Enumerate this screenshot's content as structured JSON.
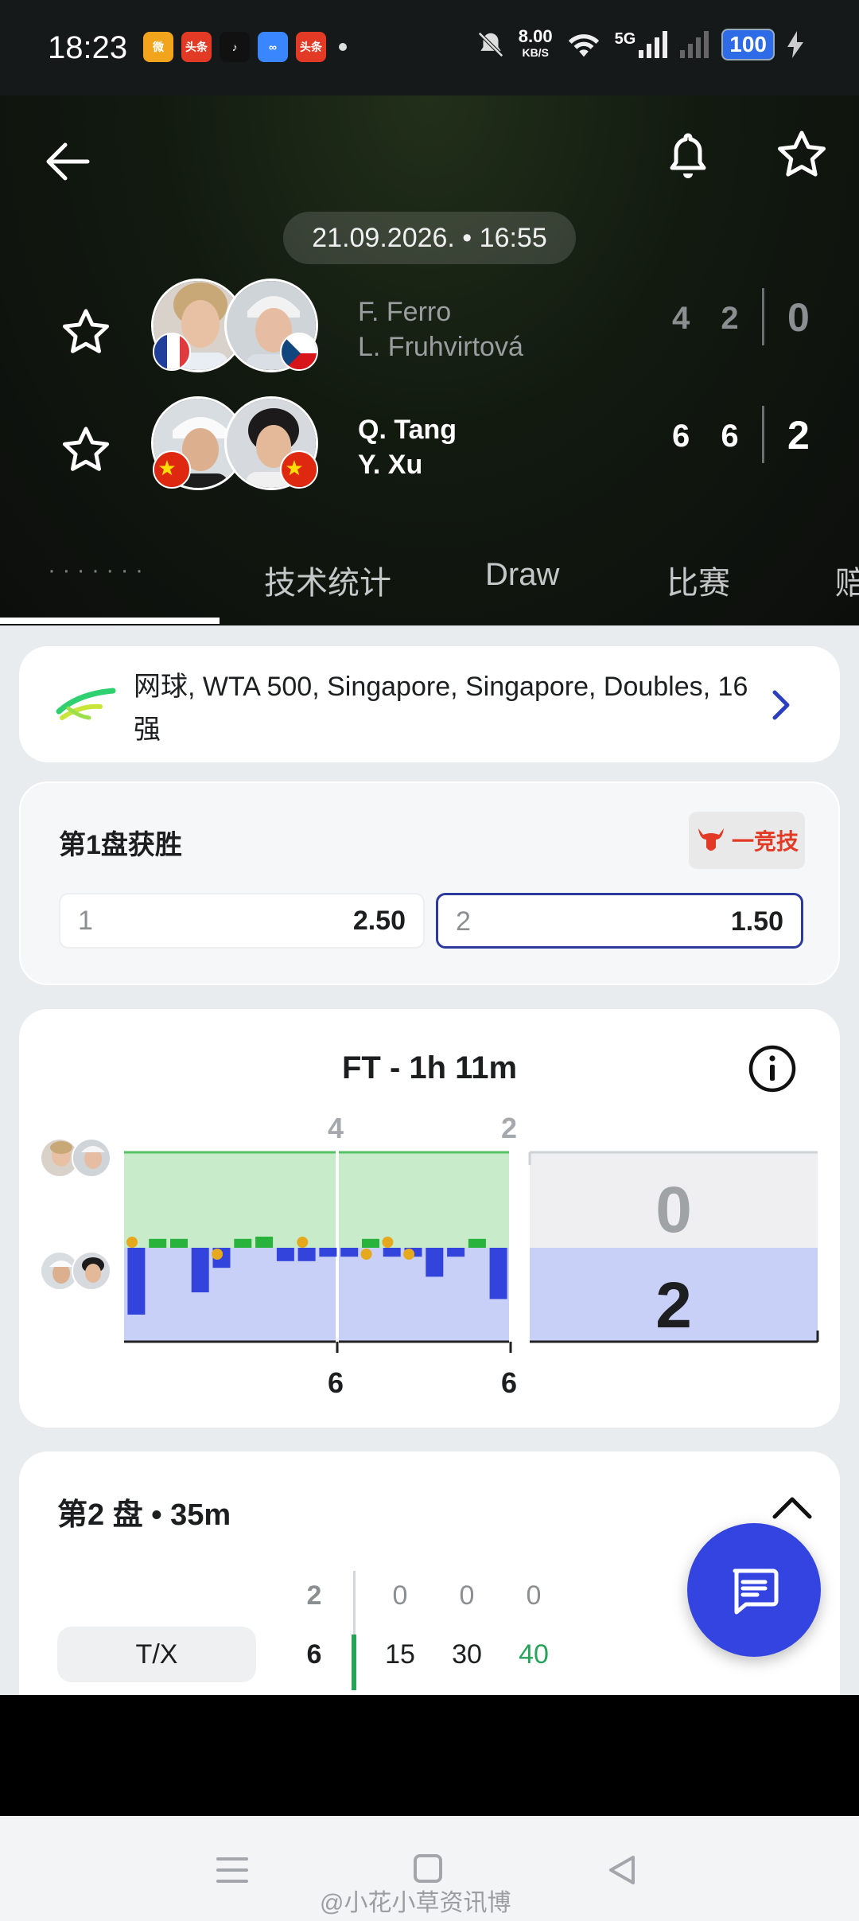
{
  "status_bar": {
    "time": "18:23",
    "app_icons": [
      {
        "name": "weibo-app-icon",
        "label": "微",
        "color": "#f2a41c"
      },
      {
        "name": "toutiao-app-icon",
        "label": "头条",
        "color": "#e23a24"
      },
      {
        "name": "tiktok-app-icon",
        "label": "♪",
        "color": "#111111"
      },
      {
        "name": "cloud-app-icon",
        "label": "∞",
        "color": "#3a86ff"
      },
      {
        "name": "toutiao-lite-app-icon",
        "label": "头条",
        "color": "#e23a24"
      }
    ],
    "net_speed": "8.00",
    "net_unit": "KB/S",
    "network": "5G",
    "battery": "100"
  },
  "header": {
    "date_time": "21.09.2026. • 16:55",
    "teams": [
      {
        "player1": "F. Ferro",
        "player2": "L. Fruhvirtová",
        "set1": "4",
        "set2": "2",
        "sets_won": "0",
        "flag1": "france",
        "flag2": "czech"
      },
      {
        "player1": "Q. Tang",
        "player2": "Y. Xu",
        "set1": "6",
        "set2": "6",
        "sets_won": "2",
        "flag1": "china",
        "flag2": "china"
      }
    ],
    "tabs": [
      "· · · · · · ·",
      "技术统计",
      "Draw",
      "比赛",
      "赔"
    ]
  },
  "league": {
    "text": "网球, WTA 500, Singapore, Singapore, Doubles, 16强"
  },
  "odds": {
    "title": "第1盘获胜",
    "brand": "一竞技",
    "options": [
      {
        "label": "1",
        "value": "2.50",
        "selected": false
      },
      {
        "label": "2",
        "value": "1.50",
        "selected": true
      }
    ],
    "accent": "#2b3a9c"
  },
  "chart_data": {
    "type": "bar",
    "title": "FT - 1h 11m",
    "top_set_labels": [
      "4",
      "2"
    ],
    "bottom_set_labels": [
      "6",
      "6"
    ],
    "score_top": "0",
    "score_bottom": "2",
    "games": [
      {
        "set": 1,
        "side": "bottom",
        "value": 3
      },
      {
        "set": 1,
        "side": "top",
        "value": 0.4
      },
      {
        "set": 1,
        "side": "top",
        "value": 0.4
      },
      {
        "set": 1,
        "side": "bottom",
        "value": 2
      },
      {
        "set": 1,
        "side": "bottom",
        "value": 0.9
      },
      {
        "set": 1,
        "side": "top",
        "value": 0.4
      },
      {
        "set": 1,
        "side": "top",
        "value": 0.5
      },
      {
        "set": 1,
        "side": "bottom",
        "value": 0.6
      },
      {
        "set": 1,
        "side": "bottom",
        "value": 0.6
      },
      {
        "set": 1,
        "side": "bottom",
        "value": 0.4
      },
      {
        "set": 2,
        "side": "bottom",
        "value": 0.4
      },
      {
        "set": 2,
        "side": "top",
        "value": 0.4
      },
      {
        "set": 2,
        "side": "bottom",
        "value": 0.4
      },
      {
        "set": 2,
        "side": "bottom",
        "value": 0.4
      },
      {
        "set": 2,
        "side": "bottom",
        "value": 1.3
      },
      {
        "set": 2,
        "side": "bottom",
        "value": 0.4
      },
      {
        "set": 2,
        "side": "top",
        "value": 0.4
      },
      {
        "set": 2,
        "side": "bottom",
        "value": 2.3
      }
    ],
    "colors": {
      "top": "#28b43c",
      "bottom": "#3344dd",
      "top_bg": "#c8ecc9",
      "bottom_bg": "#c9d0f8"
    }
  },
  "set2": {
    "title": "第2 盘 • 35m",
    "row_label": "T/X",
    "top_set_score": "2",
    "bottom_set_score": "6",
    "top_points": [
      "0",
      "0",
      "0"
    ],
    "bottom_points": [
      "15",
      "30",
      "40"
    ]
  },
  "watermark": "@小花小草资讯博"
}
